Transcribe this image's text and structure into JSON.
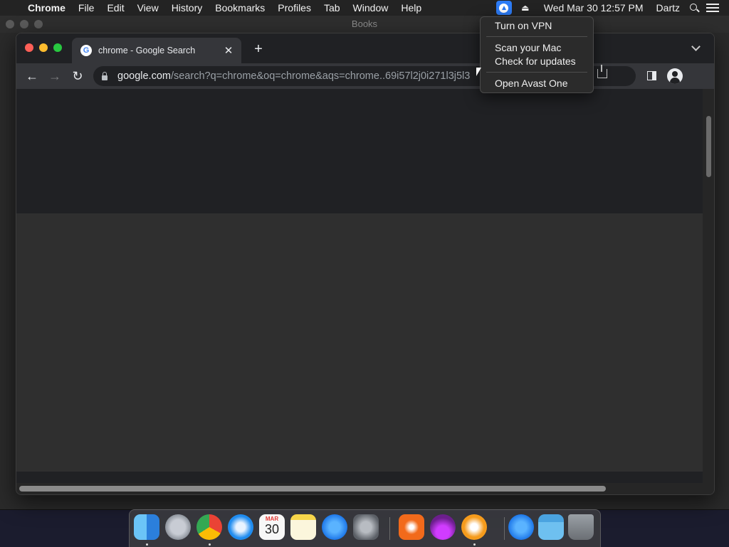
{
  "menubar": {
    "app_name": "Chrome",
    "items": [
      "File",
      "Edit",
      "View",
      "History",
      "Bookmarks",
      "Profiles",
      "Tab",
      "Window",
      "Help"
    ],
    "clock": "Wed Mar 30  12:57 PM",
    "user": "Dartz",
    "status_icons": [
      "avast-icon",
      "eject-icon",
      "search-icon",
      "control-center-icon"
    ]
  },
  "background_window": {
    "title": "Books"
  },
  "browser": {
    "tab_title": "chrome - Google Search",
    "favicon_letter": "G",
    "url_host": "google.com",
    "url_path": "/search?q=chrome&oq=chrome&aqs=chrome..69i57l2j0i271l3j5l3",
    "new_tab_symbol": "+",
    "tab_close_symbol": "✕"
  },
  "avast_menu": {
    "items": [
      "Turn on VPN",
      "Scan your Mac",
      "Check for updates",
      "Open Avast One"
    ]
  },
  "dock": {
    "calendar_month": "MAR",
    "calendar_day": "30",
    "apps": [
      "Finder",
      "Launchpad",
      "Google Chrome",
      "Safari",
      "Calendar",
      "Notes",
      "App Store",
      "System Preferences",
      "Avast One",
      "Downloads Installer",
      "Books",
      "Applications",
      "Downloads",
      "Trash"
    ]
  },
  "colors": {
    "accent_blue": "#2d7cf6",
    "chrome_bg": "#202124",
    "toolbar_bg": "#35363a",
    "avast_orange": "#f26a1b"
  }
}
